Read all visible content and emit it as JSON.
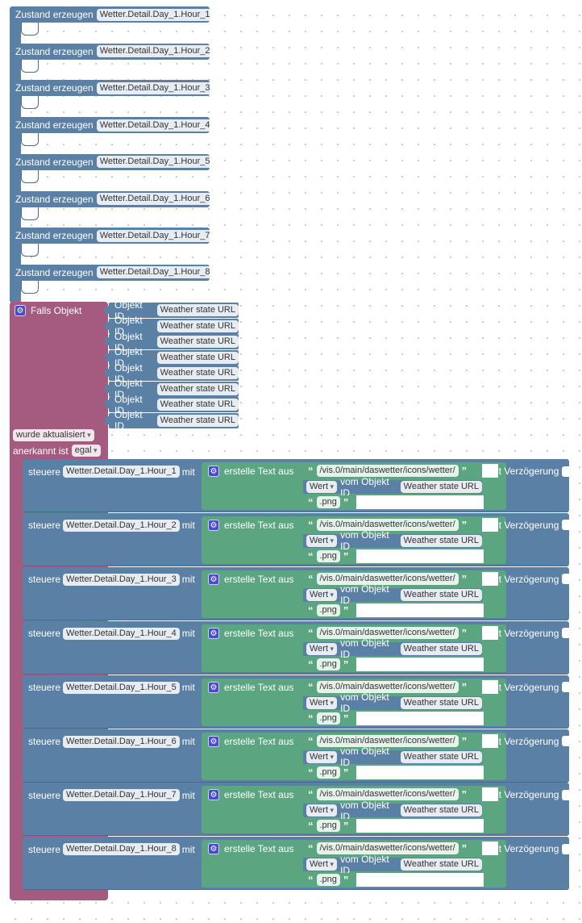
{
  "zustand": {
    "label": "Zustand erzeugen",
    "items": [
      "Wetter.Detail.Day_1.Hour_1",
      "Wetter.Detail.Day_1.Hour_2",
      "Wetter.Detail.Day_1.Hour_3",
      "Wetter.Detail.Day_1.Hour_4",
      "Wetter.Detail.Day_1.Hour_5",
      "Wetter.Detail.Day_1.Hour_6",
      "Wetter.Detail.Day_1.Hour_7",
      "Wetter.Detail.Day_1.Hour_8"
    ]
  },
  "falls": {
    "label": "Falls Objekt",
    "objekt_label": "Objekt ID",
    "objekt_value": "Weather state URL",
    "trigger": "wurde aktualisiert",
    "ack_label": "anerkannt ist",
    "ack_value": "egal"
  },
  "steuere": {
    "label": "steuere",
    "mit": "mit",
    "erstelle": "erstelle Text aus",
    "path": "/vis.0/main/daswetter/icons/wetter/",
    "wert": "Wert",
    "vom": "vom Objekt ID",
    "objekt_value": "Weather state URL",
    "ext": ".png",
    "verz": "mit Verzögerung",
    "targets": [
      "Wetter.Detail.Day_1.Hour_1",
      "Wetter.Detail.Day_1.Hour_2",
      "Wetter.Detail.Day_1.Hour_3",
      "Wetter.Detail.Day_1.Hour_4",
      "Wetter.Detail.Day_1.Hour_5",
      "Wetter.Detail.Day_1.Hour_6",
      "Wetter.Detail.Day_1.Hour_7",
      "Wetter.Detail.Day_1.Hour_8"
    ]
  },
  "colors": {
    "blue": "#5b80a5",
    "pink": "#a55b80",
    "green": "#5ba580"
  }
}
